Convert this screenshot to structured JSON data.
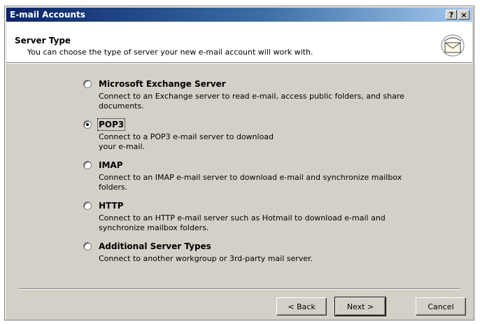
{
  "window": {
    "title": "E-mail Accounts",
    "help_label": "?",
    "close_label": "×"
  },
  "header": {
    "title": "Server Type",
    "subtitle": "You can choose the type of server your new e-mail account will work with.",
    "icon": "envelope-icon"
  },
  "options": [
    {
      "label": "Microsoft Exchange Server",
      "description": "Connect to an Exchange server to read e-mail, access public folders, and share documents.",
      "selected": false
    },
    {
      "label": "POP3",
      "description": "Connect to a POP3 e-mail server to download your e-mail.",
      "selected": true
    },
    {
      "label": "IMAP",
      "description": "Connect to an IMAP e-mail server to download e-mail and synchronize mailbox folders.",
      "selected": false
    },
    {
      "label": "HTTP",
      "description": "Connect to an HTTP e-mail server such as Hotmail to download e-mail and synchronize mailbox folders.",
      "selected": false
    },
    {
      "label": "Additional Server Types",
      "description": "Connect to another workgroup or 3rd-party mail server.",
      "selected": false
    }
  ],
  "buttons": {
    "back": "< Back",
    "next": "Next >",
    "cancel": "Cancel"
  }
}
